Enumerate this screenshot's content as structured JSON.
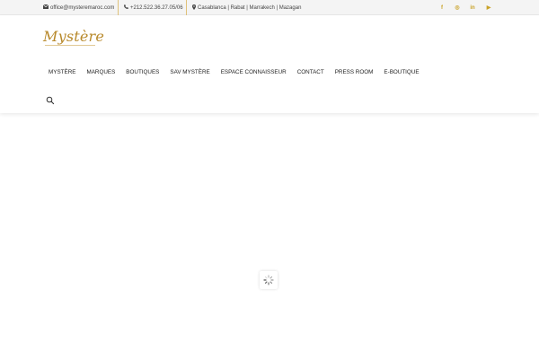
{
  "topbar": {
    "email": "office@mysteremaroc.com",
    "phone": "+212.522.36.27.05/06",
    "cities": "Casablanca | Rabat | Marrakech | Mazagan",
    "social": [
      {
        "name": "facebook-icon",
        "glyph": "f"
      },
      {
        "name": "instagram-icon",
        "glyph": "◎"
      },
      {
        "name": "linkedin-icon",
        "glyph": "in"
      },
      {
        "name": "youtube-icon",
        "glyph": "▶"
      }
    ],
    "accent_color": "#c9a227"
  },
  "header": {
    "logo_text": "Mystère",
    "nav": [
      "MYSTÈRE",
      "MARQUES",
      "BOUTIQUES",
      "SAV MYSTÈRE",
      "ESPACE CONNAISSEUR",
      "CONTACT",
      "PRESS ROOM",
      "E-BOUTIQUE"
    ]
  }
}
